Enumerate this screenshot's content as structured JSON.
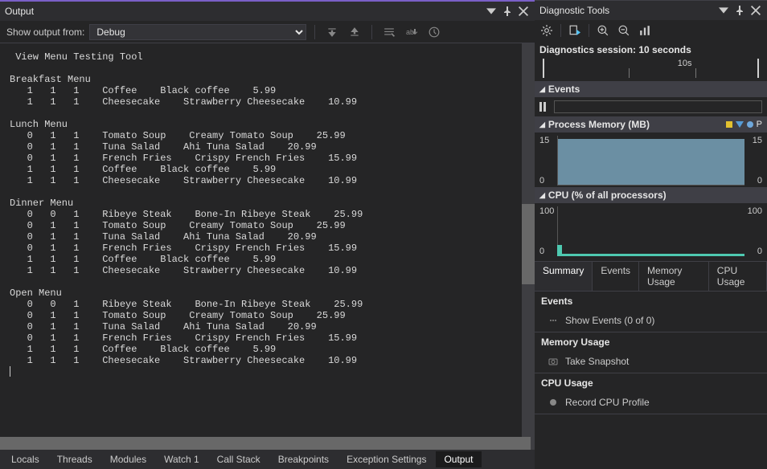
{
  "output_panel": {
    "title": "Output",
    "show_from_label": "Show output from:",
    "dropdown_value": "Debug",
    "lines": [
      " View Menu Testing Tool",
      "",
      "Breakfast Menu",
      "   1   1   1    Coffee    Black coffee    5.99",
      "   1   1   1    Cheesecake    Strawberry Cheesecake    10.99",
      "",
      "Lunch Menu",
      "   0   1   1    Tomato Soup    Creamy Tomato Soup    25.99",
      "   0   1   1    Tuna Salad    Ahi Tuna Salad    20.99",
      "   0   1   1    French Fries    Crispy French Fries    15.99",
      "   1   1   1    Coffee    Black coffee    5.99",
      "   1   1   1    Cheesecake    Strawberry Cheesecake    10.99",
      "",
      "Dinner Menu",
      "   0   0   1    Ribeye Steak    Bone-In Ribeye Steak    25.99",
      "   0   1   1    Tomato Soup    Creamy Tomato Soup    25.99",
      "   0   1   1    Tuna Salad    Ahi Tuna Salad    20.99",
      "   0   1   1    French Fries    Crispy French Fries    15.99",
      "   1   1   1    Coffee    Black coffee    5.99",
      "   1   1   1    Cheesecake    Strawberry Cheesecake    10.99",
      "",
      "Open Menu",
      "   0   0   1    Ribeye Steak    Bone-In Ribeye Steak    25.99",
      "   0   1   1    Tomato Soup    Creamy Tomato Soup    25.99",
      "   0   1   1    Tuna Salad    Ahi Tuna Salad    20.99",
      "   0   1   1    French Fries    Crispy French Fries    15.99",
      "   1   1   1    Coffee    Black coffee    5.99",
      "   1   1   1    Cheesecake    Strawberry Cheesecake    10.99"
    ]
  },
  "bottom_tabs": {
    "items": [
      "Locals",
      "Threads",
      "Modules",
      "Watch 1",
      "Call Stack",
      "Breakpoints",
      "Exception Settings",
      "Output"
    ],
    "active": "Output"
  },
  "diag_panel": {
    "title": "Diagnostic Tools",
    "session_label": "Diagnostics session: 10 seconds",
    "ruler": {
      "mark": "10s"
    },
    "events_header": "Events",
    "mem_header": "Process Memory (MB)",
    "mem_legend_p": "P",
    "cpu_header": "CPU (% of all processors)",
    "tabs": [
      "Summary",
      "Events",
      "Memory Usage",
      "CPU Usage"
    ],
    "active_tab": "Summary",
    "summary": {
      "events_head": "Events",
      "events_item": "Show Events (0 of 0)",
      "mem_head": "Memory Usage",
      "mem_item": "Take Snapshot",
      "cpu_head": "CPU Usage",
      "cpu_item": "Record CPU Profile"
    }
  },
  "chart_data": [
    {
      "type": "area",
      "title": "Process Memory (MB)",
      "x": [
        0,
        10
      ],
      "values": [
        14,
        14
      ],
      "ylim": [
        0,
        15
      ],
      "ylabel": "MB",
      "y_ticks_left": [
        "15",
        "0"
      ],
      "y_ticks_right": [
        "15",
        "0"
      ]
    },
    {
      "type": "line",
      "title": "CPU (% of all processors)",
      "x": [
        0,
        1,
        10
      ],
      "values": [
        10,
        2,
        2
      ],
      "ylim": [
        0,
        100
      ],
      "ylabel": "%",
      "y_ticks_left": [
        "100",
        "0"
      ],
      "y_ticks_right": [
        "100",
        "0"
      ]
    }
  ]
}
